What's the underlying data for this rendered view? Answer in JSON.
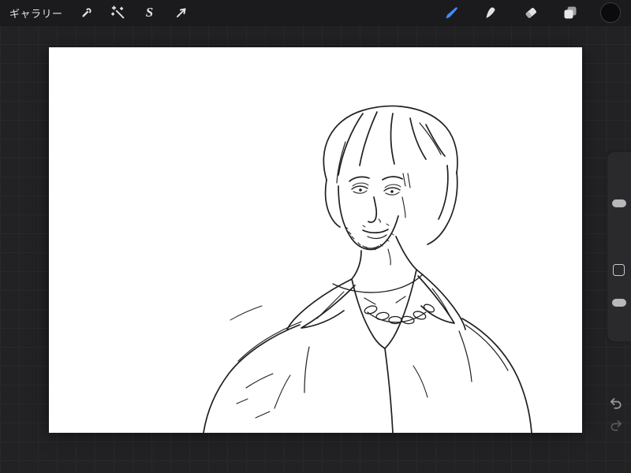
{
  "topbar": {
    "gallery_label": "ギャラリー",
    "selection_glyph": "S",
    "left_tools": [
      {
        "name": "actions",
        "icon": "wrench-icon"
      },
      {
        "name": "adjustments",
        "icon": "magic-wand-icon"
      },
      {
        "name": "selection",
        "icon": "selection-s-icon"
      },
      {
        "name": "transform",
        "icon": "transform-arrow-icon"
      }
    ],
    "right_tools": [
      {
        "name": "paint",
        "icon": "brush-icon",
        "active": true
      },
      {
        "name": "smudge",
        "icon": "smudge-icon"
      },
      {
        "name": "erase",
        "icon": "eraser-icon"
      },
      {
        "name": "layers",
        "icon": "layers-icon"
      },
      {
        "name": "color",
        "icon": "color-swatch",
        "value": "#0b0b0d"
      }
    ],
    "accent_color": "#3f8cfb",
    "icon_color": "#e2e2e5"
  },
  "canvas": {
    "background": "#ffffff",
    "artwork_description": "Monochrome ink sketch of a man with wavy chin-length hair, light stubble, scar lines over one eye, wearing an open-collared shirt with a bead necklace"
  },
  "sidebar": {
    "brush_size_slider": "brush size",
    "modify_button": "modify",
    "opacity_slider": "opacity"
  },
  "history": {
    "undo": "undo",
    "redo": "redo"
  },
  "colors": {
    "topbar_bg": "#1b1b1e",
    "workspace_bg": "#222225",
    "grid_line": "#29292c",
    "ink": "#202020"
  }
}
